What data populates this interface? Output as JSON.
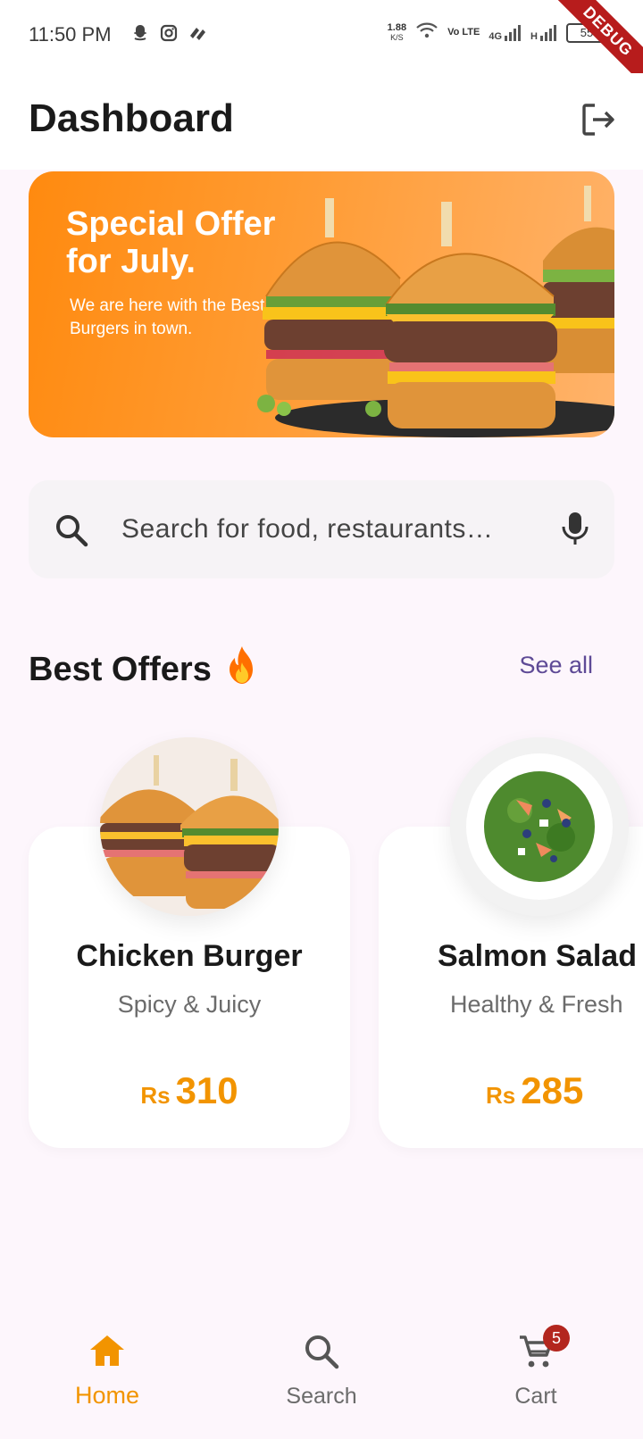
{
  "status_bar": {
    "time": "11:50 PM",
    "net_speed_value": "1.88",
    "net_speed_unit": "K/S",
    "volte": "Vo LTE",
    "signal_1": "4G",
    "signal_2": "H",
    "battery": "55",
    "debug": "DEBUG"
  },
  "header": {
    "title": "Dashboard"
  },
  "banner": {
    "title": "Special Offer for July.",
    "subtitle": "We are here with the Best Burgers in town."
  },
  "search": {
    "placeholder": "Search for food, restaurants…"
  },
  "best_offers": {
    "title": "Best Offers",
    "emoji": "🔥",
    "see_all": "See all",
    "items": [
      {
        "name": "Chicken Burger",
        "description": "Spicy & Juicy",
        "currency": "Rs",
        "price": "310"
      },
      {
        "name": "Salmon Salad",
        "description": "Healthy & Fresh",
        "currency": "Rs",
        "price": "285"
      }
    ]
  },
  "bottom_nav": {
    "items": [
      {
        "label": "Home",
        "icon": "home-icon",
        "active": true
      },
      {
        "label": "Search",
        "icon": "search-icon",
        "active": false
      },
      {
        "label": "Cart",
        "icon": "cart-icon",
        "active": false,
        "badge": "5"
      }
    ]
  },
  "colors": {
    "accent": "#f29400",
    "link": "#5e4a96",
    "badge": "#b3261e",
    "background": "#fdf6fc"
  }
}
